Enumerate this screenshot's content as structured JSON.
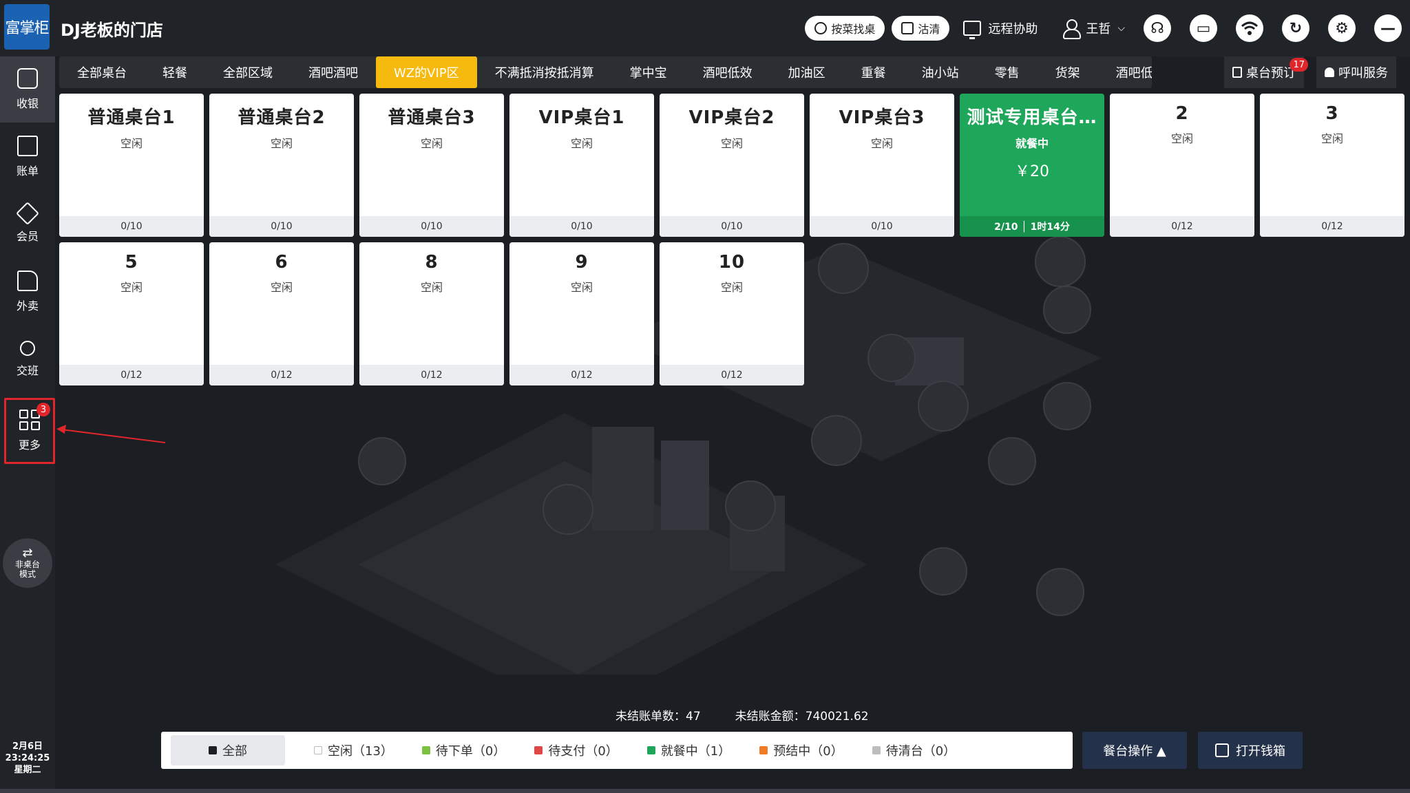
{
  "app": {
    "logo_text": "富掌柜",
    "store_name": "DJ老板的门店"
  },
  "header": {
    "find_table_label": "按菜找桌",
    "clear_label": "沽清",
    "remote_assist_label": "远程协助",
    "user_name": "王哲",
    "chevron": "⌵"
  },
  "sidebar": {
    "items": [
      {
        "label": "收银",
        "icon": "cash-register-icon"
      },
      {
        "label": "账单",
        "icon": "bill-icon"
      },
      {
        "label": "会员",
        "icon": "member-icon"
      },
      {
        "label": "外卖",
        "icon": "delivery-icon"
      },
      {
        "label": "交班",
        "icon": "shift-icon"
      },
      {
        "label": "更多",
        "icon": "grid-icon",
        "badge": "3"
      }
    ],
    "mode_line1": "非桌台",
    "mode_line2": "模式",
    "date": "2月6日",
    "time": "23:24:25",
    "weekday": "星期二"
  },
  "tabs": [
    "全部桌台",
    "轻餐",
    "全部区域",
    "酒吧酒吧",
    "WZ的VIP区",
    "不满抵消按抵消算",
    "掌中宝",
    "酒吧低效",
    "加油区",
    "重餐",
    "油小站",
    "零售",
    "货架",
    "酒吧低"
  ],
  "active_tab": "WZ的VIP区",
  "tab_right": {
    "reservation_label": "桌台预订",
    "reservation_badge": "17",
    "call_service_label": "呼叫服务"
  },
  "tables": [
    {
      "name": "普通桌台1",
      "status": "空闲",
      "footer": "0/10"
    },
    {
      "name": "普通桌台2",
      "status": "空闲",
      "footer": "0/10"
    },
    {
      "name": "普通桌台3",
      "status": "空闲",
      "footer": "0/10"
    },
    {
      "name": "VIP桌台1",
      "status": "空闲",
      "footer": "0/10"
    },
    {
      "name": "VIP桌台2",
      "status": "空闲",
      "footer": "0/10"
    },
    {
      "name": "VIP桌台3",
      "status": "空闲",
      "footer": "0/10"
    },
    {
      "name": "测试专用桌台…",
      "status": "就餐中",
      "price": "￥20",
      "footer": "2/10 │ 1时14分"
    },
    {
      "name": "2",
      "status": "空闲",
      "footer": "0/12"
    },
    {
      "name": "3",
      "status": "空闲",
      "footer": "0/12"
    },
    {
      "name": "5",
      "status": "空闲",
      "footer": "0/12"
    },
    {
      "name": "6",
      "status": "空闲",
      "footer": "0/12"
    },
    {
      "name": "8",
      "status": "空闲",
      "footer": "0/12"
    },
    {
      "name": "9",
      "status": "空闲",
      "footer": "0/12"
    },
    {
      "name": "10",
      "status": "空闲",
      "footer": "0/12"
    }
  ],
  "summary": {
    "unsettled_count": "未结账单数：47",
    "unsettled_amount": "未结账金额：740021.62"
  },
  "legend": [
    {
      "label": "全部",
      "color": "#1b1e22"
    },
    {
      "label": "空闲（13）",
      "color": "#ffffff"
    },
    {
      "label": "待下单（0）",
      "color": "#7cc242"
    },
    {
      "label": "待支付（0）",
      "color": "#e04848"
    },
    {
      "label": "就餐中（1）",
      "color": "#1ea75a"
    },
    {
      "label": "预结中（0）",
      "color": "#f07b22"
    },
    {
      "label": "待清台（0）",
      "color": "#bdbdbd"
    }
  ],
  "actions": {
    "table_ops": "餐台操作 ▲",
    "open_drawer": "打开钱箱"
  },
  "colors": {
    "accent_tab": "#f6b90e",
    "dining_green": "#1ea75a",
    "highlight_red": "#e0252b"
  }
}
